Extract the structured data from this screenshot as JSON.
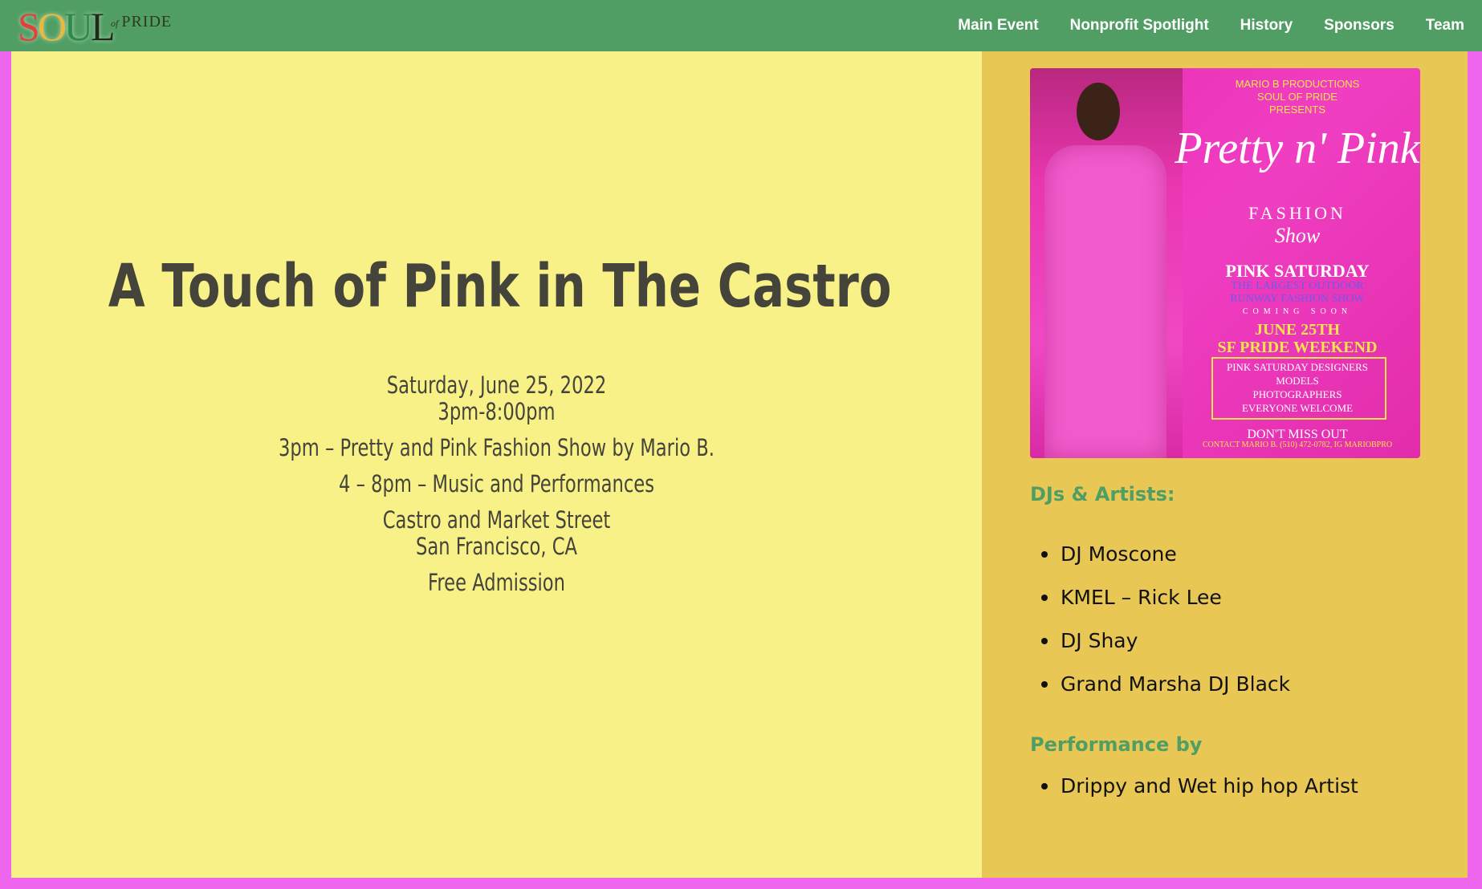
{
  "site": {
    "logo": {
      "letters": [
        "S",
        "O",
        "U",
        "L"
      ],
      "of": "of",
      "pride": "PRIDE",
      "letter_colors": [
        "#e0423a",
        "#e9b93a",
        "#2e8a4a",
        "#1e2b16"
      ]
    }
  },
  "nav": {
    "items": [
      {
        "label": "Main Event"
      },
      {
        "label": "Nonprofit Spotlight"
      },
      {
        "label": "History"
      },
      {
        "label": "Sponsors"
      },
      {
        "label": "Team"
      }
    ]
  },
  "event": {
    "title": "A Touch of Pink in The Castro",
    "date": "Saturday, June 25, 2022",
    "time": "3pm-8:00pm",
    "fashion_show": "3pm – Pretty and Pink Fashion Show by Mario B.",
    "music": "4 – 8pm – Music and Performances",
    "street": "Castro and Market Street",
    "city": "San Francisco, CA",
    "admission": "Free Admission"
  },
  "flyer": {
    "producer": "MARIO B PRODUCTIONS",
    "brand": "SOUL OF PRIDE",
    "presents": "PRESENTS",
    "script_title": "Pretty n' Pink",
    "subtitle": "FASHION",
    "script_sub": "Show",
    "event_name": "PINK SATURDAY",
    "tagline_1": "THE LARGEST OUTDOOR",
    "tagline_2": "RUNWAY FASHION SHOW",
    "coming": "COMING SOON",
    "date": "JUNE 25TH",
    "weekend": "SF PRIDE WEEKEND",
    "box_1": "PINK SATURDAY DESIGNERS",
    "box_2": "MODELS",
    "box_3": "PHOTOGRAPHERS",
    "box_4": "EVERYONE WELCOME",
    "cta": "DON'T MISS OUT",
    "contact": "CONTACT MARIO B. (510) 472-0782, IG MARIOBPRO"
  },
  "sidebar": {
    "djs_heading": "DJs & Artists:",
    "djs": [
      "DJ Moscone",
      "KMEL – Rick Lee",
      "DJ Shay",
      "Grand Marsha DJ Black"
    ],
    "performance_heading": "Performance by",
    "performers": [
      "Drippy and Wet hip hop Artist"
    ]
  },
  "colors": {
    "nav_bg": "#509e63",
    "main_bg": "#f8f187",
    "sidebar_bg": "#e8c755",
    "page_border": "#ee66ee",
    "heading_green": "#509e63",
    "text_dark": "#44443a"
  }
}
